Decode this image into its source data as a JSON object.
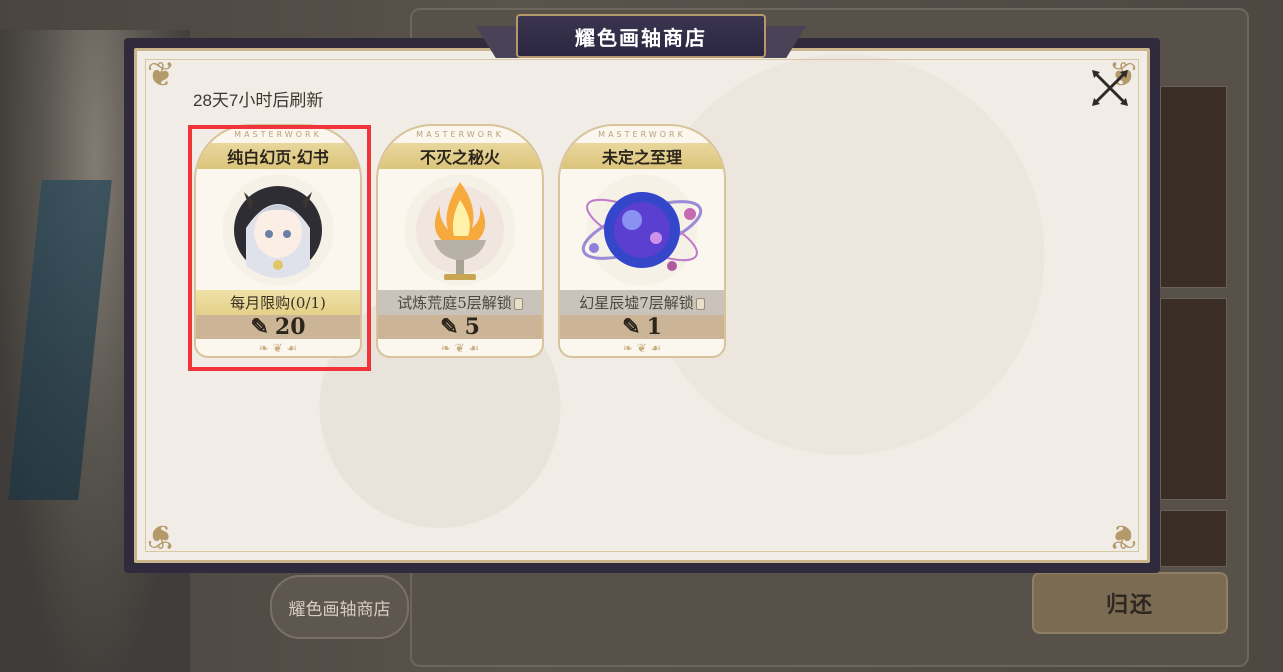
{
  "background": {
    "shop_tab_label": "耀色画轴商店",
    "return_button_label": "归还"
  },
  "modal": {
    "title": "耀色画轴商店",
    "refresh_text": "28天7小时后刷新",
    "close_icon": "crossed-swords-icon"
  },
  "cards": [
    {
      "arch_text": "MASTERWORK",
      "name": "纯白幻页·幻书",
      "art_icon": "character-portrait-icon",
      "status": "每月限购(0/1)",
      "status_type": "limit",
      "currency_icon": "scroll-icon",
      "price": "20",
      "selected": true
    },
    {
      "arch_text": "MASTERWORK",
      "name": "不灭之秘火",
      "art_icon": "flame-chalice-icon",
      "status": "试炼荒庭5层解锁",
      "status_type": "locked",
      "currency_icon": "scroll-icon",
      "price": "5",
      "selected": false
    },
    {
      "arch_text": "MASTERWORK",
      "name": "未定之至理",
      "art_icon": "cosmic-orb-icon",
      "status": "幻星辰墟7层解锁",
      "status_type": "locked",
      "currency_icon": "scroll-icon",
      "price": "1",
      "selected": false
    }
  ],
  "colors": {
    "selection_border": "#f0353a",
    "title_plate": "#2a2540",
    "card_name_band": "#dbc47a",
    "price_band": "#cbb596"
  }
}
